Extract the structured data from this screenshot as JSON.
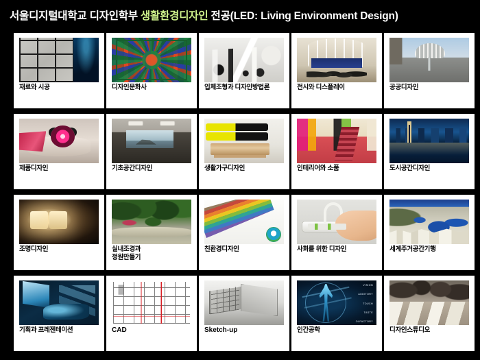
{
  "header": {
    "title_prefix": "서울디지털대학교 디자인학부 ",
    "title_highlight": "생활환경디자인",
    "title_suffix": " 전공(LED: Living Environment Design)",
    "highlight_color": "#cdf08a",
    "background_color": "#000000"
  },
  "courses": [
    {
      "label": "재료와 시공",
      "art": "art-stone"
    },
    {
      "label": "디자인문화사",
      "art": "art-dancheong"
    },
    {
      "label": "입체조형과 디자인방법론",
      "art": "art-models"
    },
    {
      "label": "전시와 디스플레이",
      "art": "art-expo"
    },
    {
      "label": "공공디자인",
      "art": "art-public"
    },
    {
      "label": "제품디자인",
      "art": "art-product"
    },
    {
      "label": "기초공간디자인",
      "art": "art-space"
    },
    {
      "label": "생활가구디자인",
      "art": "art-furni"
    },
    {
      "label": "인테리어와 소품",
      "art": "art-interior"
    },
    {
      "label": "도시공간디자인",
      "art": "art-city"
    },
    {
      "label": "조명디자인",
      "art": "art-lamp"
    },
    {
      "label": "실내조경과\n정원만들기",
      "art": "art-garden"
    },
    {
      "label": "친환경디자인",
      "art": "art-pencil"
    },
    {
      "label": "사회를 위한 디자인",
      "art": "art-social"
    },
    {
      "label": "세계주거공간기행",
      "art": "art-santorini"
    },
    {
      "label": "기획과 프레젠테이션",
      "art": "art-laptop"
    },
    {
      "label": "CAD",
      "art": "art-cad",
      "latin": true
    },
    {
      "label": "Sketch-up",
      "art": "art-sketch",
      "latin": true
    },
    {
      "label": "인간공학",
      "art": "art-ergo"
    },
    {
      "label": "디자인스튜디오",
      "art": "art-studio"
    }
  ],
  "ergonomics_image": {
    "senses": [
      "VISION",
      "AUDITORY",
      "TOUCH",
      "TASTE",
      "OLFACTORY"
    ]
  }
}
